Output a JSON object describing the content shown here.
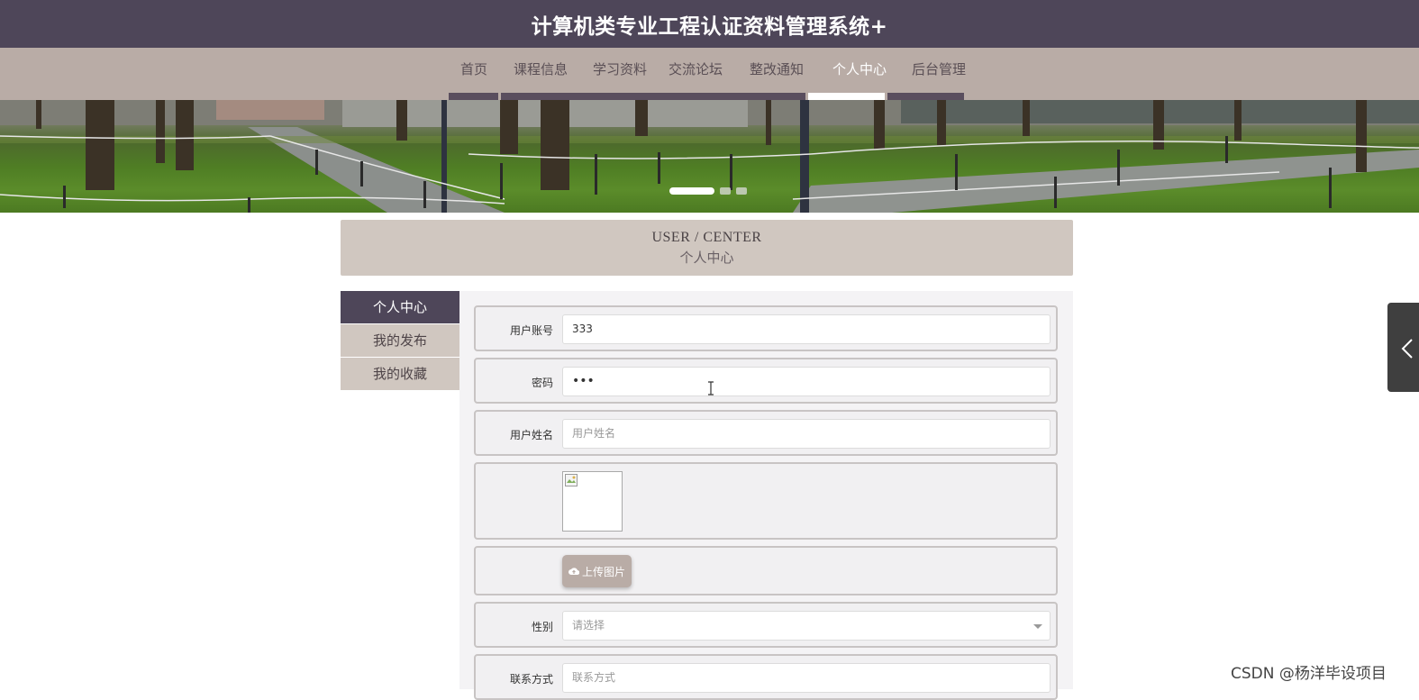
{
  "header": {
    "title": "计算机类专业工程认证资料管理系统+"
  },
  "nav": {
    "items": [
      {
        "label": "首页",
        "active": false
      },
      {
        "label": "课程信息",
        "active": false
      },
      {
        "label": "学习资料",
        "active": false
      },
      {
        "label": "交流论坛",
        "active": false
      },
      {
        "label": "整改通知",
        "active": false
      },
      {
        "label": "个人中心",
        "active": true
      },
      {
        "label": "后台管理",
        "active": false
      }
    ]
  },
  "banner": {
    "slide_count": 3,
    "active_slide": 1
  },
  "section": {
    "title_en": "USER / CENTER",
    "title_cn": "个人中心"
  },
  "sidebar": {
    "items": [
      {
        "label": "个人中心",
        "active": true
      },
      {
        "label": "我的发布",
        "active": false
      },
      {
        "label": "我的收藏",
        "active": false
      }
    ]
  },
  "form": {
    "account": {
      "label": "用户账号",
      "value": "333"
    },
    "password": {
      "label": "密码",
      "value": "•••"
    },
    "username": {
      "label": "用户姓名",
      "placeholder": "用户姓名"
    },
    "avatar": {
      "icon": "broken-image-icon"
    },
    "upload": {
      "label": "上传图片",
      "icon": "cloud-upload-icon"
    },
    "gender": {
      "label": "性别",
      "placeholder": "请选择"
    },
    "contact": {
      "label": "联系方式",
      "placeholder": "联系方式"
    }
  },
  "colors": {
    "topbar": "#4e4659",
    "navbar": "#b9aca6",
    "sidebar_active": "#4e4659",
    "sidebar_inactive": "#d0c7c0",
    "section_head": "#d0c7c0"
  },
  "watermark": {
    "text": "CSDN @杨洋毕设项目"
  }
}
